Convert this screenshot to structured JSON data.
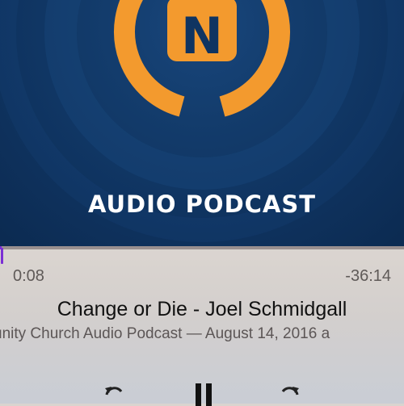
{
  "artwork": {
    "logo_letter": "N",
    "label": "AUDIO PODCAST",
    "colors": {
      "background": "#0f3461",
      "logo": "#f39a2e"
    }
  },
  "player": {
    "progress_fraction": 0.004,
    "elapsed": "0:08",
    "remaining": "-36:14",
    "title": "Change or Die - Joel Schmidgall",
    "subtitle": "unity Church Audio Podcast — August 14, 2016 a",
    "accent_color": "#7b2fd4"
  },
  "controls": {
    "rewind_icon": "rewind-15-icon",
    "play_pause_icon": "pause-icon",
    "forward_icon": "forward-15-icon"
  }
}
